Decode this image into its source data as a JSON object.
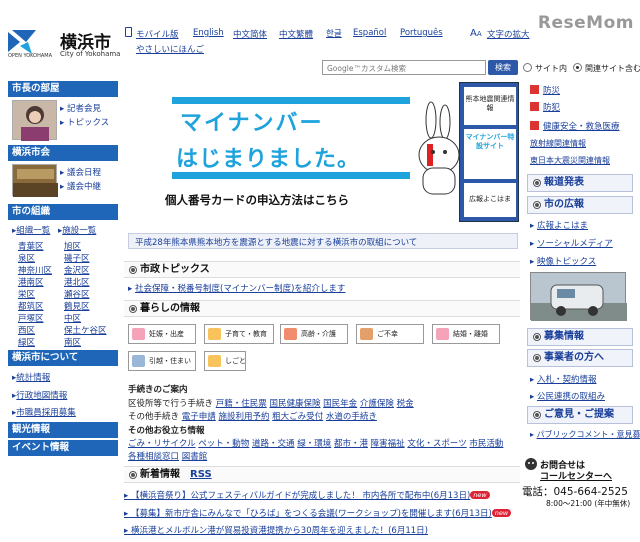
{
  "header": {
    "city_name": "横浜市",
    "city_name_en": "City of Yokohama",
    "open_label": "OPEN YOKOHAMA",
    "languages": {
      "mobile": "モバイル版",
      "english": "English",
      "zh_simplified": "中文简体",
      "zh_traditional": "中文繁體",
      "korean": "한글",
      "spanish": "Español",
      "portuguese": "Português",
      "easy_japanese": "やさしいにほんご"
    },
    "font_size_label": "文字の拡大",
    "resemom": "ReseMom",
    "search": {
      "placeholder": "Google™カスタム検索",
      "button": "検索",
      "option_site": "サイト内",
      "option_related": "関連サイト含む"
    }
  },
  "left_nav": {
    "mayor": {
      "title": "市長の部屋",
      "links": [
        "記者会見",
        "トピックス"
      ]
    },
    "council": {
      "title": "横浜市会",
      "links": [
        "議会日程",
        "議会中継"
      ]
    },
    "org": {
      "title": "市の組織",
      "links": [
        "組織一覧",
        "施設一覧"
      ],
      "wards": [
        "青葉区",
        "旭区",
        "泉区",
        "磯子区",
        "神奈川区",
        "金沢区",
        "港南区",
        "港北区",
        "栄区",
        "瀬谷区",
        "都筑区",
        "鶴見区",
        "戸塚区",
        "中区",
        "西区",
        "保土ケ谷区",
        "緑区",
        "南区"
      ]
    },
    "about": {
      "title": "横浜市について",
      "links": [
        "統計情報",
        "行政地図情報",
        "市職員採用募集"
      ]
    },
    "tourism": {
      "title": "観光情報"
    },
    "events": {
      "title": "イベント情報"
    }
  },
  "banner": {
    "line1": "マイナンバー",
    "line2": "はじまりました。",
    "sub": "個人番号カードの申込方法はこちら",
    "panel_top": "熊本地震関連情報",
    "panel_mid": "マイナンバー特設サイト",
    "panel_bottom": "広報よこはま"
  },
  "notice": "平成28年熊本県熊本地方を震源とする地震に対する横浜市の取組について",
  "city_topics": {
    "title": "市政トピックス",
    "link": "社会保障・税番号制度(マイナンバー制度)を紹介します"
  },
  "living": {
    "title": "暮らしの情報",
    "categories": [
      "妊娠・出産",
      "子育て・教育",
      "高齢・介護",
      "ご不幸",
      "結婚・離婚",
      "引越・住まい",
      "しごと"
    ],
    "procedures_title": "手続きのご案内",
    "ward_label": "区役所等で行う手続き",
    "ward_links": [
      "戸籍・住民票",
      "国民健康保険",
      "国民年金",
      "介護保険",
      "税金"
    ],
    "other_label": "その他手続き",
    "other_links": [
      "電子申請",
      "施設利用予約",
      "粗大ごみ受付",
      "水道の手続き"
    ],
    "useful_title": "その他お役立ち情報",
    "useful_links_1": [
      "ごみ・リサイクル",
      "ペット・動物",
      "道路・交通",
      "緑・環境",
      "都市・港",
      "障害福祉",
      "文化・スポーツ",
      "市民活動"
    ],
    "useful_links_2": [
      "各種相談窓口",
      "図書館"
    ]
  },
  "news": {
    "title": "新着情報",
    "rss": "RSS",
    "items": [
      "【横浜音祭り】公式フェスティバルガイドが完成しました！ 市内各所で配布中(6月13日)",
      "【募集】新市庁舎にみんなで「ひろば」をつくる会議(ワークショップ)を開催します(6月13日)",
      "横浜港とメルボルン港が貿易投資港提携から30周年を迎えました！(6月11日)"
    ],
    "new_badge": "new"
  },
  "right": {
    "top_links": [
      "防災",
      "防犯",
      "健康安全・救急医療",
      "放射線関連情報",
      "東日本大震災関連情報"
    ],
    "press": "報道発表",
    "pr": "市の広報",
    "pr_links": [
      "広報よこはま",
      "ソーシャルメディア",
      "映像トピックス"
    ],
    "recruit": "募集情報",
    "business": "事業者の方へ",
    "business_links": [
      "入札・契約情報",
      "公民連携の取組み"
    ],
    "opinion": "ご意見・ご提案",
    "opinion_links": [
      "パブリックコメント・意見募集"
    ],
    "contact_title": "お問合せは",
    "contact_sub": "コールセンターへ",
    "phone": "電話：045-664-2525",
    "hours": "8:00～21:00 (年中無休)"
  },
  "colors": {
    "nav_blue": "#1f66b8",
    "banner_cyan": "#1fa3dc",
    "link": "#1a3f9a"
  }
}
